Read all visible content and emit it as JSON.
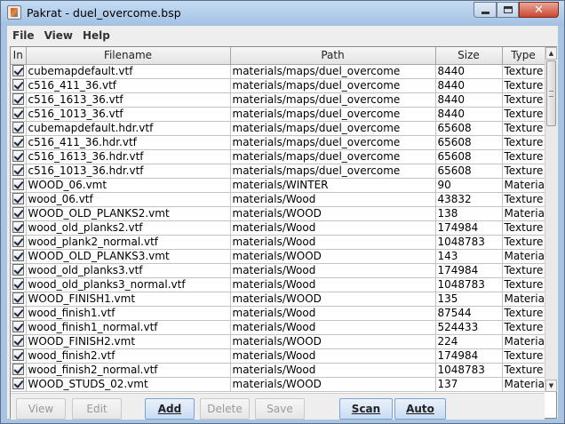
{
  "window": {
    "title": "Pakrat - duel_overcome.bsp",
    "controls": {
      "minimize": "minimize",
      "maximize": "maximize",
      "close": "close"
    }
  },
  "menu": [
    "File",
    "View",
    "Help"
  ],
  "table": {
    "columns": [
      "In",
      "Filename",
      "Path",
      "Size",
      "Type"
    ],
    "rows": [
      {
        "checked": true,
        "filename": "cubemapdefault.vtf",
        "path": "materials/maps/duel_overcome",
        "size": "8440",
        "type": "Texture"
      },
      {
        "checked": true,
        "filename": "c516_411_36.vtf",
        "path": "materials/maps/duel_overcome",
        "size": "8440",
        "type": "Texture"
      },
      {
        "checked": true,
        "filename": "c516_1613_36.vtf",
        "path": "materials/maps/duel_overcome",
        "size": "8440",
        "type": "Texture"
      },
      {
        "checked": true,
        "filename": "c516_1013_36.vtf",
        "path": "materials/maps/duel_overcome",
        "size": "8440",
        "type": "Texture"
      },
      {
        "checked": true,
        "filename": "cubemapdefault.hdr.vtf",
        "path": "materials/maps/duel_overcome",
        "size": "65608",
        "type": "Texture"
      },
      {
        "checked": true,
        "filename": "c516_411_36.hdr.vtf",
        "path": "materials/maps/duel_overcome",
        "size": "65608",
        "type": "Texture"
      },
      {
        "checked": true,
        "filename": "c516_1613_36.hdr.vtf",
        "path": "materials/maps/duel_overcome",
        "size": "65608",
        "type": "Texture"
      },
      {
        "checked": true,
        "filename": "c516_1013_36.hdr.vtf",
        "path": "materials/maps/duel_overcome",
        "size": "65608",
        "type": "Texture"
      },
      {
        "checked": true,
        "filename": "WOOD_06.vmt",
        "path": "materials/WINTER",
        "size": "90",
        "type": "Material"
      },
      {
        "checked": true,
        "filename": "wood_06.vtf",
        "path": "materials/Wood",
        "size": "43832",
        "type": "Texture"
      },
      {
        "checked": true,
        "filename": "WOOD_OLD_PLANKS2.vmt",
        "path": "materials/WOOD",
        "size": "138",
        "type": "Material"
      },
      {
        "checked": true,
        "filename": "wood_old_planks2.vtf",
        "path": "materials/Wood",
        "size": "174984",
        "type": "Texture"
      },
      {
        "checked": true,
        "filename": "wood_plank2_normal.vtf",
        "path": "materials/Wood",
        "size": "1048783",
        "type": "Texture"
      },
      {
        "checked": true,
        "filename": "WOOD_OLD_PLANKS3.vmt",
        "path": "materials/WOOD",
        "size": "143",
        "type": "Material"
      },
      {
        "checked": true,
        "filename": "wood_old_planks3.vtf",
        "path": "materials/Wood",
        "size": "174984",
        "type": "Texture"
      },
      {
        "checked": true,
        "filename": "wood_old_planks3_normal.vtf",
        "path": "materials/Wood",
        "size": "1048783",
        "type": "Texture"
      },
      {
        "checked": true,
        "filename": "WOOD_FINISH1.vmt",
        "path": "materials/WOOD",
        "size": "135",
        "type": "Material"
      },
      {
        "checked": true,
        "filename": "wood_finish1.vtf",
        "path": "materials/Wood",
        "size": "87544",
        "type": "Texture"
      },
      {
        "checked": true,
        "filename": "wood_finish1_normal.vtf",
        "path": "materials/Wood",
        "size": "524433",
        "type": "Texture"
      },
      {
        "checked": true,
        "filename": "WOOD_FINISH2.vmt",
        "path": "materials/WOOD",
        "size": "224",
        "type": "Material"
      },
      {
        "checked": true,
        "filename": "wood_finish2.vtf",
        "path": "materials/Wood",
        "size": "174984",
        "type": "Texture"
      },
      {
        "checked": true,
        "filename": "wood_finish2_normal.vtf",
        "path": "materials/Wood",
        "size": "1048783",
        "type": "Texture"
      },
      {
        "checked": true,
        "filename": "WOOD_STUDS_02.vmt",
        "path": "materials/WOOD",
        "size": "137",
        "type": "Material"
      }
    ]
  },
  "buttons": [
    {
      "label": "View",
      "enabled": false
    },
    {
      "label": "Edit",
      "enabled": false
    },
    {
      "label": "Add",
      "enabled": true
    },
    {
      "label": "Delete",
      "enabled": false
    },
    {
      "label": "Save",
      "enabled": false
    },
    {
      "label": "Scan",
      "enabled": true
    },
    {
      "label": "Auto",
      "enabled": true
    }
  ],
  "colors": {
    "titlebar": "#a9c4e2",
    "close_button": "#c9462f",
    "panel_bg": "#eeeeee"
  }
}
